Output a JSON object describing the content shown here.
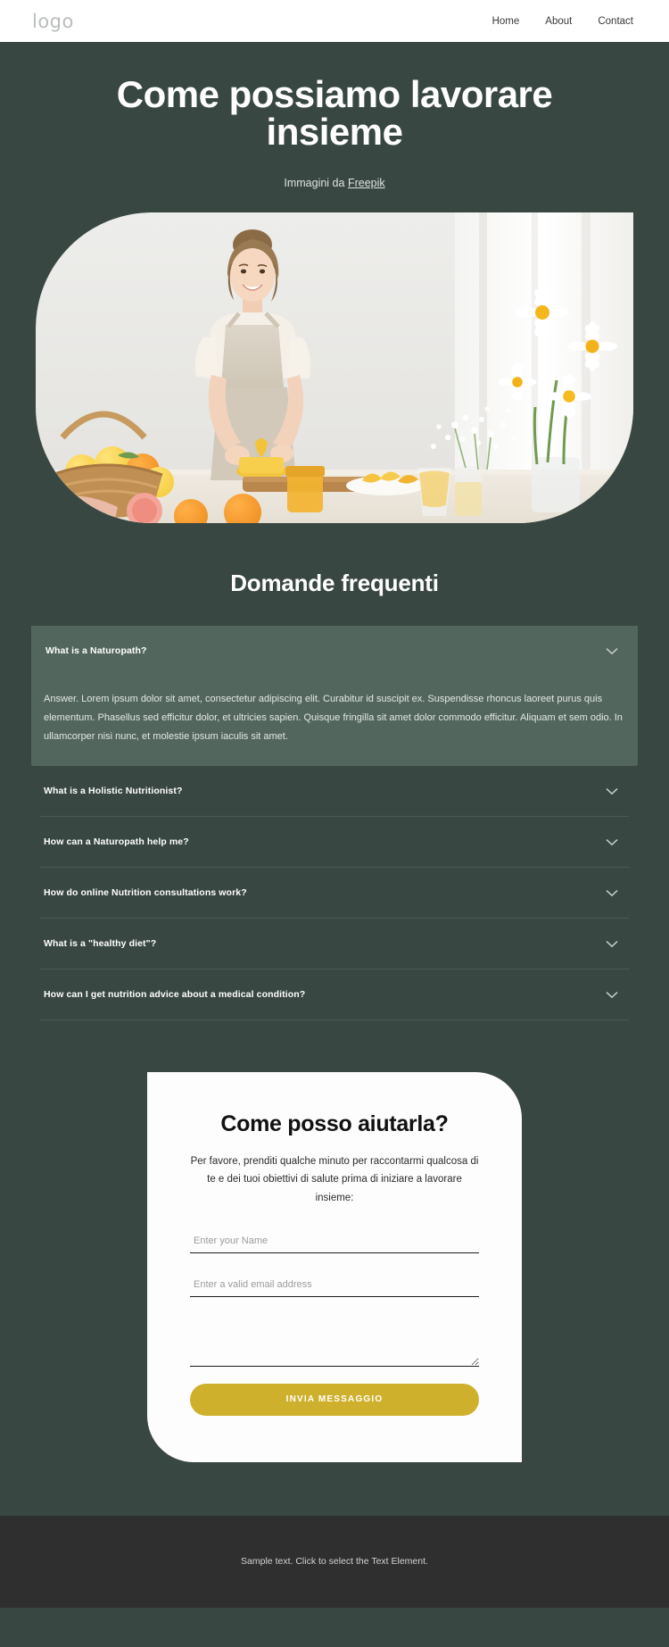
{
  "header": {
    "logo": "logo",
    "nav": [
      {
        "label": "Home"
      },
      {
        "label": "About"
      },
      {
        "label": "Contact"
      }
    ]
  },
  "hero": {
    "title": "Come possiamo lavorare insieme",
    "credit_prefix": "Immagini da ",
    "credit_link": "Freepik",
    "image_alt": "Donna sorridente che spreme agrumi in cucina con cesto di arance e limoni, margherite e fiori bianchi"
  },
  "faq": {
    "title": "Domande frequenti",
    "items": [
      {
        "question": "What is a Naturopath?",
        "answer": "Answer. Lorem ipsum dolor sit amet, consectetur adipiscing elit. Curabitur id suscipit ex. Suspendisse rhoncus laoreet purus quis elementum. Phasellus sed efficitur dolor, et ultricies sapien. Quisque fringilla sit amet dolor commodo efficitur. Aliquam et sem odio. In ullamcorper nisi nunc, et molestie ipsum iaculis sit amet.",
        "open": true
      },
      {
        "question": "What is a Holistic Nutritionist?",
        "answer": "",
        "open": false
      },
      {
        "question": "How can a Naturopath help me?",
        "answer": "",
        "open": false
      },
      {
        "question": "How do online Nutrition consultations work?",
        "answer": "",
        "open": false
      },
      {
        "question": "What is a \"healthy diet\"?",
        "answer": "",
        "open": false
      },
      {
        "question": "How can I get nutrition advice about a medical condition?",
        "answer": "",
        "open": false
      }
    ]
  },
  "contact": {
    "title": "Come posso aiutarla?",
    "subtitle": "Per favore, prenditi qualche minuto per raccontarmi qualcosa di te e dei tuoi obiettivi di salute prima di iniziare a lavorare insieme:",
    "name_placeholder": "Enter your Name",
    "name_value": "",
    "email_placeholder": "Enter a valid email address",
    "email_value": "",
    "message_placeholder": "",
    "message_value": "",
    "submit_label": "INVIA MESSAGGIO"
  },
  "footer": {
    "text": "Sample text. Click to select the Text Element."
  },
  "colors": {
    "page_background": "#384741",
    "header_background": "#ffffff",
    "accordion_active": "#53665d",
    "card_background": "#fdfdfd",
    "button": "#cfb02c",
    "footer_background": "#2f2f2f"
  }
}
